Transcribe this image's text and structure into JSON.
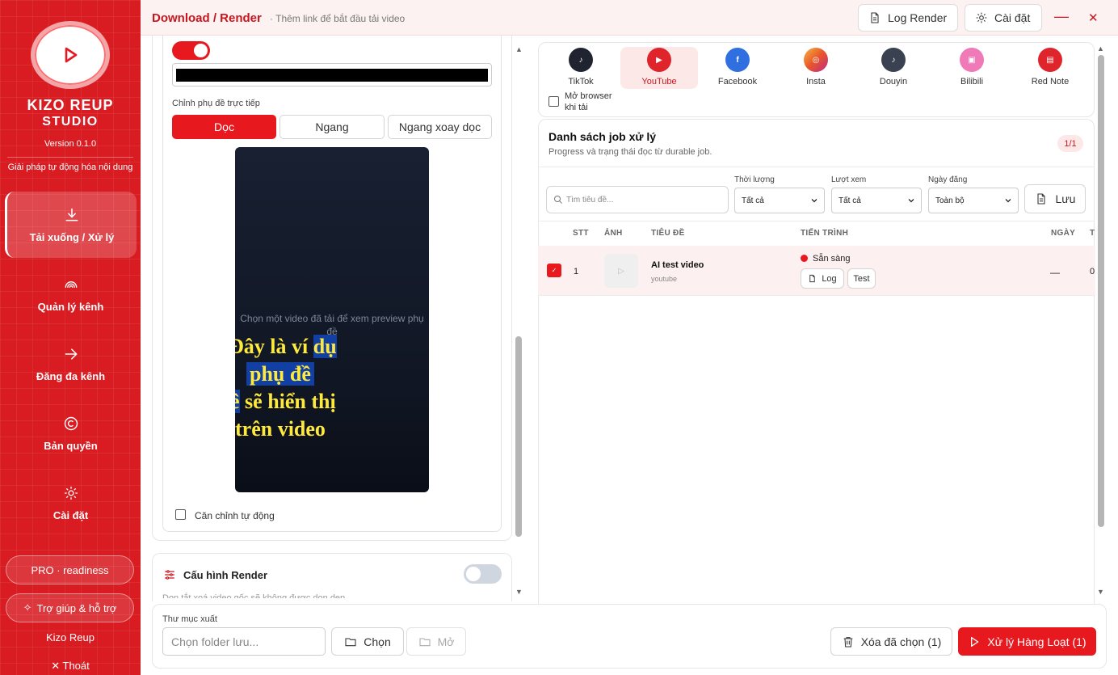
{
  "sidebar": {
    "brand_line1": "KIZO REUP",
    "brand_line2": "STUDIO",
    "version": "Version 0.1.0",
    "tagline": "Giải pháp tự động hóa nội dung",
    "nav": [
      {
        "label": "Tải xuống / Xử lý",
        "icon": "download-icon",
        "active": true
      },
      {
        "label": "Quản lý kênh",
        "icon": "broadcast-icon"
      },
      {
        "label": "Đăng đa kênh",
        "icon": "arrow-right-icon"
      },
      {
        "label": "Bản quyền",
        "icon": "copyright-icon"
      },
      {
        "label": "Cài đặt",
        "icon": "sun-gear-icon"
      }
    ],
    "pro_label": "PRO · readiness",
    "help_label": "Trợ giúp & hỗ trợ",
    "app_name": "Kizo Reup",
    "logout_label": "Thoát",
    "accent": "#d81c22"
  },
  "header": {
    "title": "Download / Render",
    "subtitle": "· Thêm link để bắt đầu tải video",
    "log_render": "Log Render",
    "settings": "Cài đặt",
    "minimize": "—",
    "close": "✕"
  },
  "subtitle_editor": {
    "live_label": "Chỉnh phụ đề trực tiếp",
    "orientations": [
      "Dọc",
      "Ngang",
      "Ngang xoay dọc"
    ],
    "active_orientation": "Dọc",
    "preview_hint": "Chọn một video đã tải để xem preview phụ đề",
    "subtitle_lines": [
      "Đây là ví",
      "dụ",
      "phụ đề",
      "ề",
      "sẽ hiển thị",
      "trên video"
    ],
    "auto_align_label": "Căn chỉnh tự động"
  },
  "render_config": {
    "title": "Cấu hình Render",
    "subtitle": "Dọn tắt xoá video gốc sẽ không được dọn dẹp"
  },
  "platforms": {
    "items": [
      {
        "label": "TikTok",
        "color": "#1f2430"
      },
      {
        "label": "YouTube",
        "color": "#e0242b",
        "active": true
      },
      {
        "label": "Facebook",
        "color": "#2f6fe0"
      },
      {
        "label": "Insta",
        "color": "#e8552a"
      },
      {
        "label": "Douyin",
        "color": "#3a4150"
      },
      {
        "label": "Bilibili",
        "color": "#f07ab8"
      },
      {
        "label": "Red Note",
        "color": "#e0242b"
      }
    ],
    "open_browser_label": "Mở browser khi tải"
  },
  "jobs": {
    "title": "Danh sách job xử lý",
    "subtitle": "Progress và trạng thái đọc từ durable job.",
    "page_badge": "1/1",
    "search_placeholder": "Tìm tiêu đề...",
    "filters": [
      {
        "label": "Thời lượng",
        "value": "Tất cả"
      },
      {
        "label": "Lượt xem",
        "value": "Tất cả"
      },
      {
        "label": "Ngày đăng",
        "value": "Toàn bộ"
      }
    ],
    "save_label": "Lưu",
    "columns": [
      "STT",
      "ẢNH",
      "TIÊU ĐỀ",
      "TIẾN TRÌNH",
      "NGÀY",
      "T"
    ],
    "rows": [
      {
        "stt": "1",
        "title": "AI test video",
        "source": "youtube",
        "status": "Sẵn sàng",
        "status_color": "#e8181f",
        "date": "—",
        "extra": "0",
        "actions": [
          "Log",
          "Test"
        ]
      }
    ]
  },
  "bottom": {
    "output_label": "Thư mục xuất",
    "folder_placeholder": "Chọn folder lưu...",
    "choose_label": "Chọn",
    "open_label": "Mở",
    "delete_label": "Xóa đã chọn (1)",
    "process_label": "Xử lý Hàng Loạt (1)"
  }
}
